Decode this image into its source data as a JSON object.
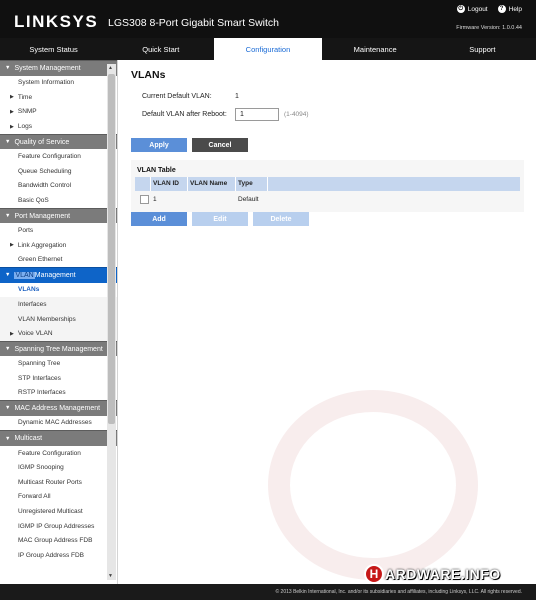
{
  "header": {
    "logo": "LINKSYS",
    "product": "LGS308 8-Port Gigabit Smart Switch",
    "logout_label": "Logout",
    "help_label": "Help",
    "firmware": "Firmware Version: 1.0.0.44"
  },
  "nav": {
    "tabs": [
      {
        "label": "System Status"
      },
      {
        "label": "Quick Start"
      },
      {
        "label": "Configuration"
      },
      {
        "label": "Maintenance"
      },
      {
        "label": "Support"
      }
    ],
    "active": "Configuration"
  },
  "sidebar": {
    "system_management": "System Management",
    "system_information": "System Information",
    "time": "Time",
    "snmp": "SNMP",
    "logs": "Logs",
    "quality_of_service": "Quality of Service",
    "feature_configuration": "Feature Configuration",
    "queue_scheduling": "Queue Scheduling",
    "bandwidth_control": "Bandwidth Control",
    "basic_qos": "Basic QoS",
    "port_management": "Port Management",
    "ports": "Ports",
    "link_aggregation": "Link Aggregation",
    "green_ethernet": "Green Ethernet",
    "vlan_management_hl": "VLAN",
    "vlan_management_rest": " Management",
    "vlans": "VLANs",
    "interfaces": "Interfaces",
    "vlan_memberships": "VLAN Memberships",
    "voice_vlan": "Voice VLAN",
    "spanning_tree_management": "Spanning Tree Management",
    "spanning_tree": "Spanning Tree",
    "stp_interfaces": "STP Interfaces",
    "rstp_interfaces": "RSTP Interfaces",
    "mac_address_management": "MAC Address Management",
    "dynamic_mac_addresses": "Dynamic MAC Addresses",
    "multicast": "Multicast",
    "mc_feature_configuration": "Feature Configuration",
    "igmp_snooping": "IGMP Snooping",
    "multicast_router_ports": "Multicast Router Ports",
    "forward_all": "Forward All",
    "unregistered_multicast": "Unregistered Multicast",
    "igmp_ip_group_addresses": "IGMP IP Group Addresses",
    "mac_group_address_fdb": "MAC Group Address FDB",
    "ip_group_address_fdb": "IP Group Address FDB"
  },
  "main": {
    "title": "VLANs",
    "current_default_label": "Current Default VLAN:",
    "current_default_value": "1",
    "after_reboot_label": "Default VLAN after Reboot:",
    "after_reboot_value": "1",
    "range_hint": "(1-4094)",
    "apply_label": "Apply",
    "cancel_label": "Cancel",
    "table": {
      "title": "VLAN Table",
      "columns": [
        "VLAN ID",
        "VLAN Name",
        "Type"
      ],
      "rows": [
        {
          "vlan_id": "1",
          "vlan_name": "",
          "type": "Default"
        }
      ]
    },
    "add_label": "Add",
    "edit_label": "Edit",
    "delete_label": "Delete"
  },
  "watermark": {
    "h": "H",
    "text": "ARDWARE.INFO"
  },
  "footer": {
    "copyright": "© 2013 Belkin International, Inc. and/or its subsidiaries and affiliates, including Linksys, LLC. All rights reserved."
  }
}
